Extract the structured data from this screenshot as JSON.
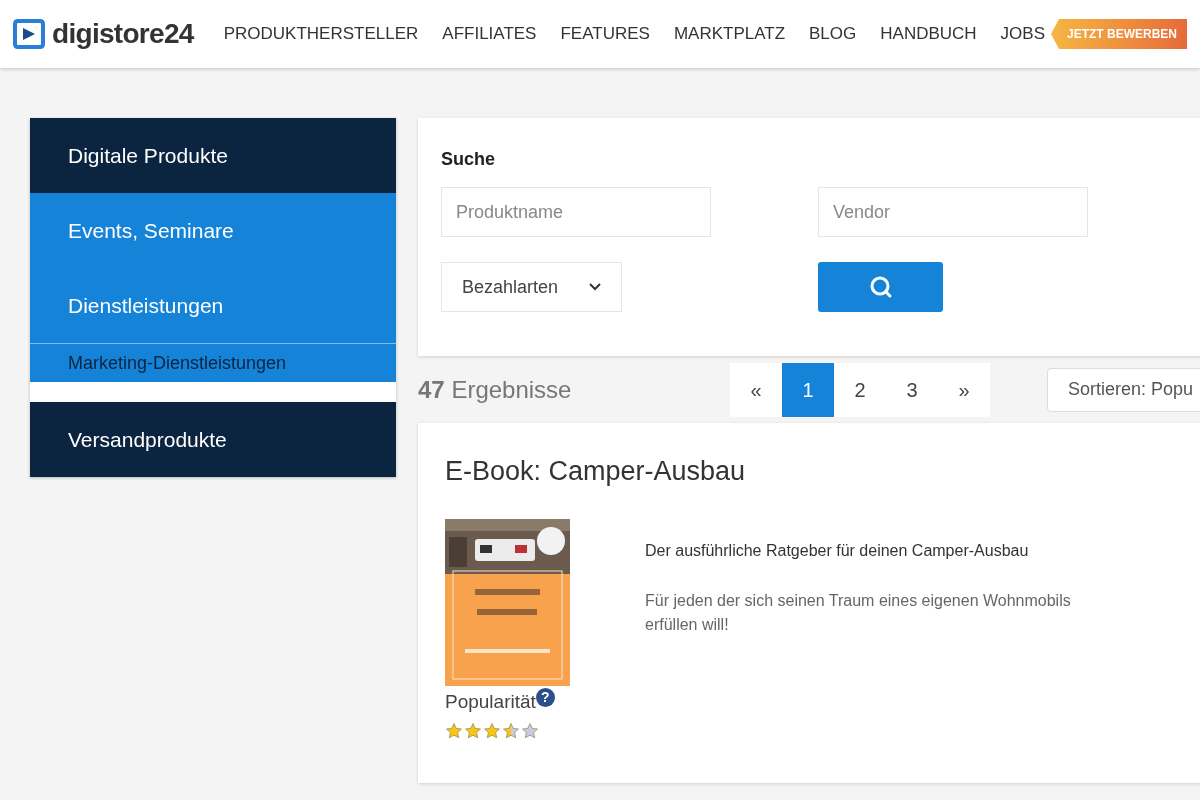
{
  "header": {
    "logo": "digistore24",
    "nav": [
      "PRODUKTHERSTELLER",
      "AFFILIATES",
      "FEATURES",
      "MARKTPLATZ",
      "BLOG",
      "HANDBUCH",
      "JOBS"
    ],
    "badge": "JETZT BEWERBEN"
  },
  "sidebar": {
    "items": [
      {
        "label": "Digitale Produkte",
        "selected": false
      },
      {
        "label": "Events, Seminare",
        "selected": true
      },
      {
        "label": "Dienstleistungen",
        "selected": true,
        "children": [
          {
            "label": "Marketing-Dienstleistungen",
            "selected": false
          }
        ]
      },
      {
        "label": "Versandprodukte",
        "selected": false
      }
    ]
  },
  "search": {
    "title": "Suche",
    "product_field": {
      "placeholder": "Produktname"
    },
    "vendor_field": {
      "placeholder": "Vendor"
    },
    "payment_select": {
      "value": "Bezahlarten"
    }
  },
  "results": {
    "count": "47",
    "label": "Ergebnisse",
    "sort": "Sortieren: Popu"
  },
  "pagination": [
    {
      "label": "«",
      "selected": false
    },
    {
      "label": "1",
      "selected": true
    },
    {
      "label": "2",
      "selected": false
    },
    {
      "label": "3",
      "selected": false
    },
    {
      "label": "»",
      "selected": false
    }
  ],
  "product": {
    "title": "E-Book: Camper-Ausbau",
    "popularity_label": "Popularität",
    "help": "?",
    "stars": 3.5,
    "headline": "Der ausführliche Ratgeber für deinen Camper-Ausbau",
    "description": "Für jeden der sich seinen Traum eines eigenen Wohnmobils erfüllen will!"
  }
}
